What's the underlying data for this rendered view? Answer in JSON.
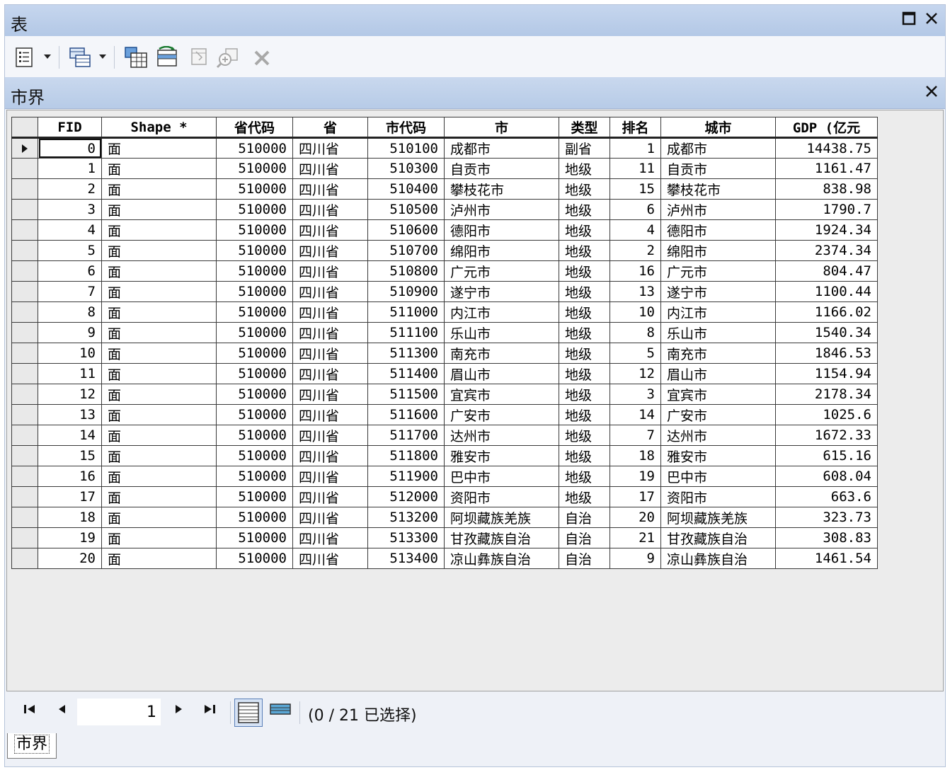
{
  "window": {
    "title": "表"
  },
  "layer": {
    "name": "市界"
  },
  "toolbar": {
    "items": [
      "table-options-icon",
      "related-tables-icon",
      "select-by-attributes-icon",
      "switch-selection-icon",
      "clear-selection-icon",
      "zoom-to-selected-icon",
      "delete-selected-icon"
    ]
  },
  "table": {
    "columns": [
      "FID",
      "Shape *",
      "省代码",
      "省",
      "市代码",
      "市",
      "类型",
      "排名",
      "城市",
      "GDP (亿元"
    ],
    "rows": [
      [
        "0",
        "面",
        "510000",
        "四川省",
        "510100",
        "成都市",
        "副省",
        "1",
        "成都市",
        "14438.75"
      ],
      [
        "1",
        "面",
        "510000",
        "四川省",
        "510300",
        "自贡市",
        "地级",
        "11",
        "自贡市",
        "1161.47"
      ],
      [
        "2",
        "面",
        "510000",
        "四川省",
        "510400",
        "攀枝花市",
        "地级",
        "15",
        "攀枝花市",
        "838.98"
      ],
      [
        "3",
        "面",
        "510000",
        "四川省",
        "510500",
        "泸州市",
        "地级",
        "6",
        "泸州市",
        "1790.7"
      ],
      [
        "4",
        "面",
        "510000",
        "四川省",
        "510600",
        "德阳市",
        "地级",
        "4",
        "德阳市",
        "1924.34"
      ],
      [
        "5",
        "面",
        "510000",
        "四川省",
        "510700",
        "绵阳市",
        "地级",
        "2",
        "绵阳市",
        "2374.34"
      ],
      [
        "6",
        "面",
        "510000",
        "四川省",
        "510800",
        "广元市",
        "地级",
        "16",
        "广元市",
        "804.47"
      ],
      [
        "7",
        "面",
        "510000",
        "四川省",
        "510900",
        "遂宁市",
        "地级",
        "13",
        "遂宁市",
        "1100.44"
      ],
      [
        "8",
        "面",
        "510000",
        "四川省",
        "511000",
        "内江市",
        "地级",
        "10",
        "内江市",
        "1166.02"
      ],
      [
        "9",
        "面",
        "510000",
        "四川省",
        "511100",
        "乐山市",
        "地级",
        "8",
        "乐山市",
        "1540.34"
      ],
      [
        "10",
        "面",
        "510000",
        "四川省",
        "511300",
        "南充市",
        "地级",
        "5",
        "南充市",
        "1846.53"
      ],
      [
        "11",
        "面",
        "510000",
        "四川省",
        "511400",
        "眉山市",
        "地级",
        "12",
        "眉山市",
        "1154.94"
      ],
      [
        "12",
        "面",
        "510000",
        "四川省",
        "511500",
        "宜宾市",
        "地级",
        "3",
        "宜宾市",
        "2178.34"
      ],
      [
        "13",
        "面",
        "510000",
        "四川省",
        "511600",
        "广安市",
        "地级",
        "14",
        "广安市",
        "1025.6"
      ],
      [
        "14",
        "面",
        "510000",
        "四川省",
        "511700",
        "达州市",
        "地级",
        "7",
        "达州市",
        "1672.33"
      ],
      [
        "15",
        "面",
        "510000",
        "四川省",
        "511800",
        "雅安市",
        "地级",
        "18",
        "雅安市",
        "615.16"
      ],
      [
        "16",
        "面",
        "510000",
        "四川省",
        "511900",
        "巴中市",
        "地级",
        "19",
        "巴中市",
        "608.04"
      ],
      [
        "17",
        "面",
        "510000",
        "四川省",
        "512000",
        "资阳市",
        "地级",
        "17",
        "资阳市",
        "663.6"
      ],
      [
        "18",
        "面",
        "510000",
        "四川省",
        "513200",
        "阿坝藏族羌族",
        "自治",
        "20",
        "阿坝藏族羌族",
        "323.73"
      ],
      [
        "19",
        "面",
        "510000",
        "四川省",
        "513300",
        "甘孜藏族自治",
        "自治",
        "21",
        "甘孜藏族自治",
        "308.83"
      ],
      [
        "20",
        "面",
        "510000",
        "四川省",
        "513400",
        "凉山彝族自治",
        "自治",
        "9",
        "凉山彝族自治",
        "1461.54"
      ]
    ]
  },
  "navigation": {
    "current_record": "1",
    "selection_status": "(0 / 21 已选择)"
  },
  "tabs": [
    {
      "label": "市界"
    }
  ]
}
